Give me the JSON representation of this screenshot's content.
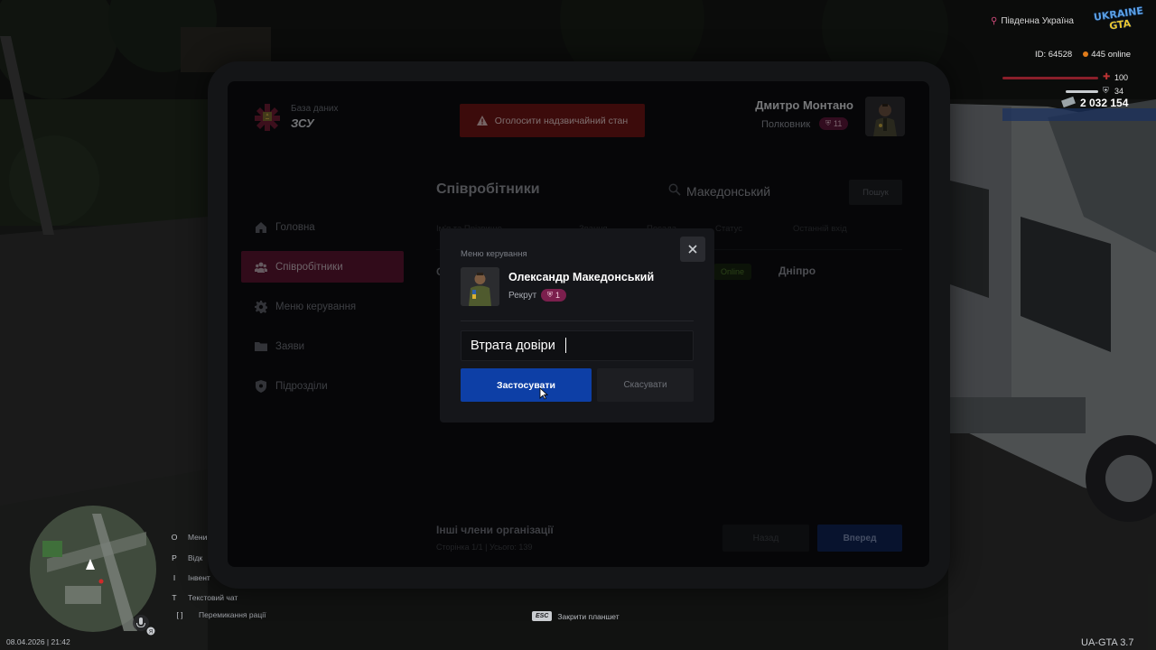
{
  "hud": {
    "region": "Південна Україна",
    "logo_top": "UKRAINE",
    "logo_bottom": "GTA",
    "player_id": "ID: 64528",
    "online": "445 online",
    "health": "100",
    "armor": "34",
    "money": "2 032 154"
  },
  "tablet": {
    "brand_sub": "База даних",
    "brand_title": "ЗСУ",
    "emergency_label": "Оголосити надзвичайний стан",
    "user": {
      "name": "Дмитро Монтано",
      "rank": "Полковник",
      "rank_level": "11"
    },
    "nav": [
      {
        "label": "Головна",
        "icon": "home-icon",
        "active": false
      },
      {
        "label": "Співробітники",
        "icon": "users-icon",
        "active": true
      },
      {
        "label": "Меню керування",
        "icon": "gear-icon",
        "active": false
      },
      {
        "label": "Заяви",
        "icon": "folder-icon",
        "active": false
      },
      {
        "label": "Підрозділи",
        "icon": "shield-icon",
        "active": false
      }
    ],
    "section_title": "Співробітники",
    "search": {
      "value": "Македонський",
      "button": "Пошук"
    },
    "table_headers": [
      "Ім'я та Прізвище",
      "Звання",
      "Посада",
      "Статус",
      "Останній вхід"
    ],
    "row": {
      "first_letter": "О",
      "status": "Online",
      "city": "Дніпро"
    },
    "others_title": "Інші члени організації",
    "others_page": "Сторінка 1/1 | Усього: 139",
    "back_label": "Назад",
    "next_label": "Вперед"
  },
  "modal": {
    "label": "Меню керування",
    "employee_name": "Олександр Македонський",
    "employee_rank": "Рекрут",
    "employee_rank_level": "1",
    "reason_value": "Втрата довіри",
    "apply_label": "Застосувати",
    "cancel_label": "Скасувати"
  },
  "keys": [
    {
      "key": "O",
      "label": "Мени"
    },
    {
      "key": "P",
      "label": "Відк"
    },
    {
      "key": "I",
      "label": "Інвент"
    },
    {
      "key": "T",
      "label": "Текстовий чат"
    },
    {
      "key": "[ ]",
      "label": "Перемикання рації"
    }
  ],
  "esc_hint": {
    "key": "ESC",
    "label": "Закрити планшет"
  },
  "datetime": "08.04.2026 | 21:42",
  "version": "UA-GTA 3.7",
  "colors": {
    "accent_crimson": "#5a1430",
    "apply_blue": "#0d3fa6",
    "emergency_red": "#6e1414"
  }
}
